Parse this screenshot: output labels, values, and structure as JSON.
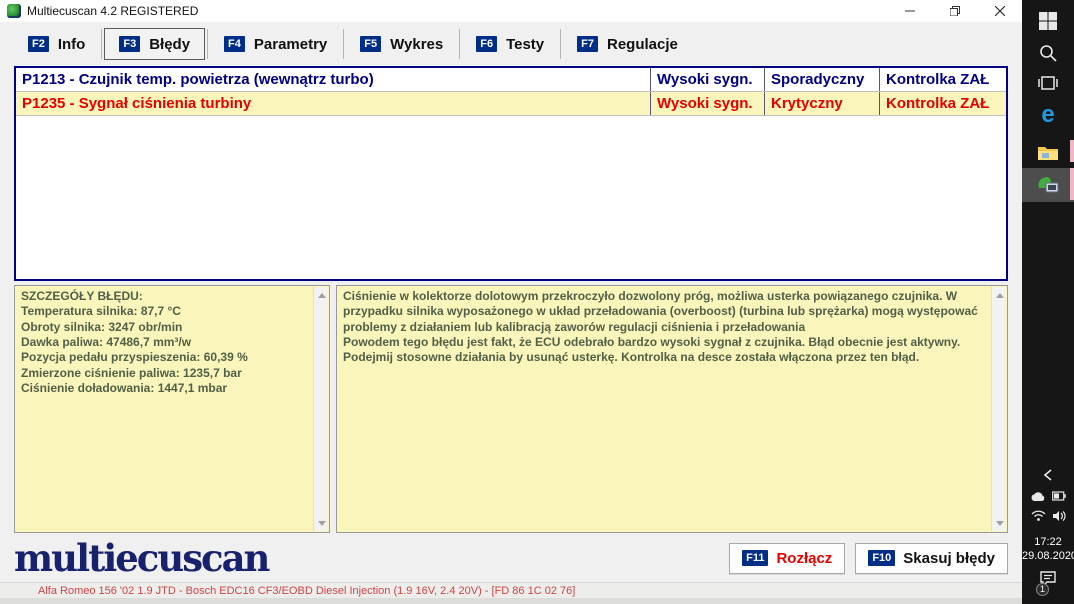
{
  "window": {
    "title": "Multiecuscan 4.2 REGISTERED"
  },
  "tabs": [
    {
      "key": "F2",
      "label": "Info"
    },
    {
      "key": "F3",
      "label": "Błędy"
    },
    {
      "key": "F4",
      "label": "Parametry"
    },
    {
      "key": "F5",
      "label": "Wykres"
    },
    {
      "key": "F6",
      "label": "Testy"
    },
    {
      "key": "F7",
      "label": "Regulacje"
    }
  ],
  "errors": [
    {
      "code_desc": "P1213 - Czujnik temp. powietrza (wewnątrz turbo)",
      "signal": "Wysoki sygn.",
      "status": "Sporadyczny",
      "lamp": "Kontrolka ZAŁ"
    },
    {
      "code_desc": "P1235 - Sygnał ciśnienia turbiny",
      "signal": "Wysoki sygn.",
      "status": "Krytyczny",
      "lamp": "Kontrolka ZAŁ"
    }
  ],
  "details": {
    "title": "SZCZEGÓŁY BŁĘDU:",
    "lines": [
      "Temperatura silnika: 87,7 °C",
      "Obroty silnika: 3247 obr/min",
      "Dawka paliwa: 47486,7 mm³/w",
      "Pozycja pedału przyspieszenia: 60,39 %",
      "Zmierzone ciśnienie paliwa: 1235,7 bar",
      "Ciśnienie doładowania: 1447,1 mbar"
    ]
  },
  "description": {
    "paragraphs": [
      "Ciśnienie w kolektorze dolotowym przekroczyło dozwolony próg, możliwa usterka powiązanego czujnika. W przypadku silnika wyposażonego w układ przeładowania (overboost) (turbina lub sprężarka) mogą występować problemy z działaniem lub kalibracją zaworów regulacji ciśnienia i przeładowania",
      "Powodem tego błędu jest fakt, że ECU odebrało bardzo wysoki sygnał z czujnika. Błąd obecnie jest aktywny. Podejmij stosowne działania by usunąć usterkę. Kontrolka na desce została włączona przez ten błąd."
    ]
  },
  "footer": {
    "logo": "multiecuscan",
    "buttons": [
      {
        "key": "F11",
        "label": "Rozłącz"
      },
      {
        "key": "F10",
        "label": "Skasuj błędy"
      }
    ]
  },
  "statusbar": {
    "text": "Alfa Romeo 156 '02 1.9 JTD - Bosch EDC16 CF3/EOBD Diesel Injection (1.9 16V, 2.4 20V) - [FD 86 1C 02 76]"
  },
  "taskbar": {
    "time": "17:22",
    "date": "29.08.2020",
    "notification_count": "1",
    "edge_glyph": "e"
  },
  "colors": {
    "navy_text": "#000080",
    "critical_red": "#e50000",
    "panel_yellow": "#faf6bb",
    "detail_green": "#505f47",
    "fkey_blue": "#002d86",
    "logo_blue": "#18216e",
    "status_red": "#cc4444",
    "taskbar_black": "#161616",
    "edge_blue": "#1e9be0"
  }
}
